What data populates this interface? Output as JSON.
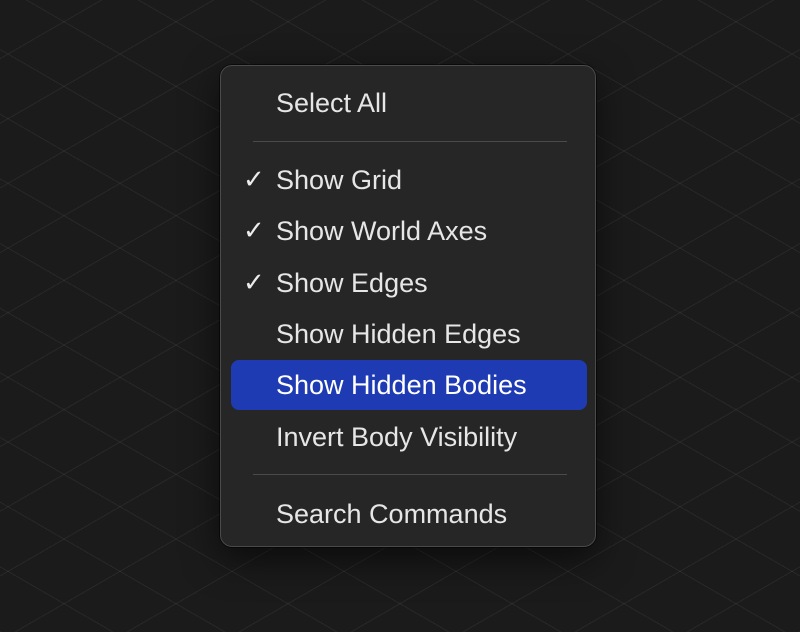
{
  "context_menu": {
    "items": [
      {
        "label": "Select All",
        "checked": false
      },
      {
        "label": "Show Grid",
        "checked": true
      },
      {
        "label": "Show World Axes",
        "checked": true
      },
      {
        "label": "Show Edges",
        "checked": true
      },
      {
        "label": "Show Hidden Edges",
        "checked": false
      },
      {
        "label": "Show Hidden Bodies",
        "checked": false,
        "highlighted": true
      },
      {
        "label": "Invert Body Visibility",
        "checked": false
      },
      {
        "label": "Search Commands",
        "checked": false
      }
    ],
    "check_glyph": "✓",
    "highlight_color": "#1f3bb3",
    "menu_background": "#262626"
  }
}
